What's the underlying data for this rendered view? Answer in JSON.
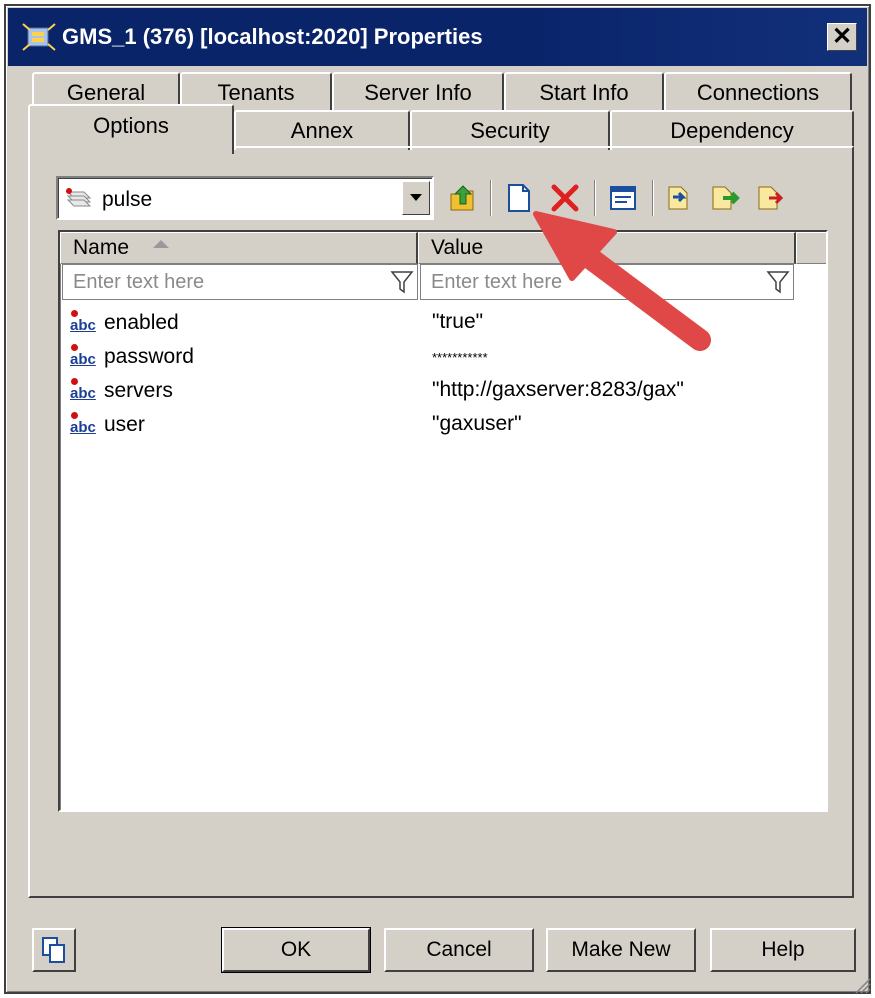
{
  "window": {
    "title": "GMS_1 (376) [localhost:2020] Properties",
    "close_glyph": "✕"
  },
  "tabs": {
    "back_row": [
      {
        "label": "General"
      },
      {
        "label": "Tenants"
      },
      {
        "label": "Server Info"
      },
      {
        "label": "Start Info"
      },
      {
        "label": "Connections"
      }
    ],
    "front_row": [
      {
        "label": "Options",
        "active": true
      },
      {
        "label": "Annex"
      },
      {
        "label": "Security"
      },
      {
        "label": "Dependency"
      }
    ]
  },
  "section_combo": {
    "value": "pulse",
    "icon": "stacked-sheets-icon"
  },
  "toolbar": {
    "icons": [
      "up-folder-icon",
      "new-document-icon",
      "delete-icon",
      "edit-properties-icon",
      "import-icon",
      "export-icon",
      "export-red-icon"
    ]
  },
  "grid": {
    "columns": [
      "Name",
      "Value"
    ],
    "filter_placeholder": "Enter text here",
    "rows": [
      {
        "type": "abc",
        "name": "enabled",
        "value": "\"true\""
      },
      {
        "type": "abc",
        "name": "password",
        "value": "***********"
      },
      {
        "type": "abc",
        "name": "servers",
        "value": "\"http://gaxserver:8283/gax\""
      },
      {
        "type": "abc",
        "name": "user",
        "value": "\"gaxuser\""
      }
    ]
  },
  "buttons": {
    "ok": "OK",
    "cancel": "Cancel",
    "make_new": "Make New",
    "help": "Help"
  },
  "colors": {
    "titlebar": "#0a246a",
    "dialog": "#d4d0c8",
    "annotation_arrow": "#e04848"
  }
}
